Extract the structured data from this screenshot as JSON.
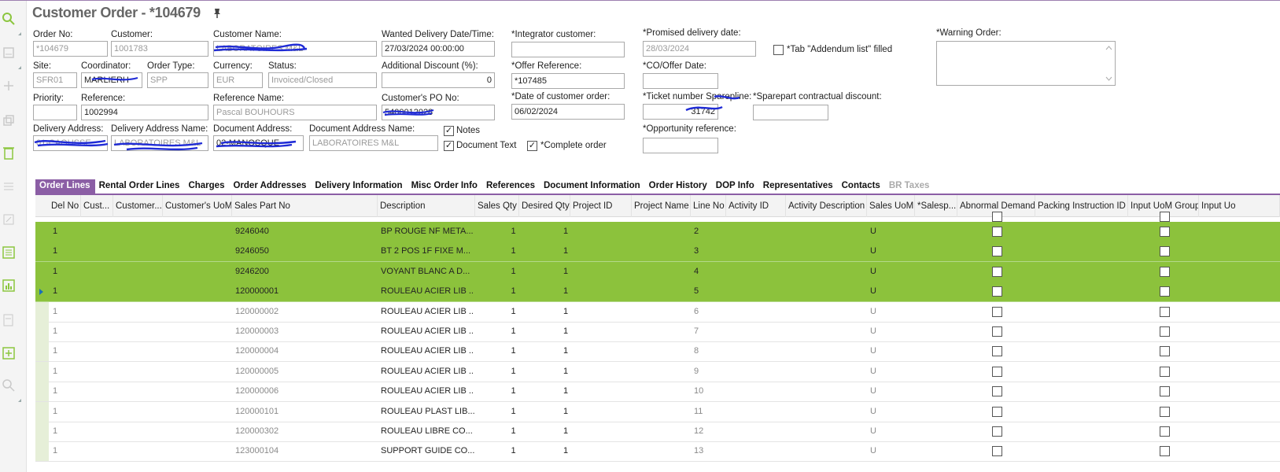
{
  "title": "Customer Order - *104679",
  "header": {
    "order_no": {
      "label": "Order No:",
      "value": "*104679"
    },
    "customer": {
      "label": "Customer:",
      "value": "1001783"
    },
    "customer_name": {
      "label": "Customer Name:",
      "value": "LABORATOIRES M&L"
    },
    "wanted_delivery": {
      "label": "Wanted Delivery Date/Time:",
      "value": "27/03/2024 00:00:00"
    },
    "integrator_customer": {
      "label": "*Integrator customer:",
      "value": ""
    },
    "promised_delivery": {
      "label": "*Promised delivery date:",
      "value": "28/03/2024"
    },
    "tab_addendum": {
      "label": "*Tab \"Addendum list\" filled"
    },
    "warning_order": {
      "label": "*Warning Order:",
      "value": ""
    },
    "site": {
      "label": "Site:",
      "value": "SFR01"
    },
    "coordinator": {
      "label": "Coordinator:",
      "value": "MARLIERH"
    },
    "order_type": {
      "label": "Order Type:",
      "value": "SPP"
    },
    "currency": {
      "label": "Currency:",
      "value": "EUR"
    },
    "status": {
      "label": "Status:",
      "value": "Invoiced/Closed"
    },
    "additional_discount": {
      "label": "Additional Discount (%):",
      "value": "0"
    },
    "offer_reference": {
      "label": "*Offer Reference:",
      "value": "*107485"
    },
    "co_offer_date": {
      "label": "*CO/Offer Date:",
      "value": ""
    },
    "priority": {
      "label": "Priority:",
      "value": ""
    },
    "reference": {
      "label": "Reference:",
      "value": "1002994"
    },
    "reference_name": {
      "label": "Reference Name:",
      "value": "Pascal BOUHOURS"
    },
    "customer_po": {
      "label": "Customer's PO No:",
      "value": "5400012028"
    },
    "date_customer_order": {
      "label": "*Date of customer order:",
      "value": "06/02/2024"
    },
    "ticket_number": {
      "label": "*Ticket number Sparepline:",
      "value": "31742"
    },
    "sparepart_discount": {
      "label": "*Sparepart contractual discount:",
      "value": ""
    },
    "delivery_address": {
      "label": "Delivery Address:",
      "value": "01-CAOUSSE"
    },
    "delivery_address_name": {
      "label": "Delivery Address Name:",
      "value": "LABORATOIRES M&L"
    },
    "document_address": {
      "label": "Document Address:",
      "value": "02-MANOSQUE"
    },
    "document_address_name": {
      "label": "Document Address Name:",
      "value": "LABORATOIRES M&L"
    },
    "notes": {
      "label": "Notes",
      "checked": true
    },
    "document_text": {
      "label": "Document Text",
      "checked": true
    },
    "complete_order": {
      "label": "*Complete order",
      "checked": true
    },
    "opportunity_reference": {
      "label": "*Opportunity reference:",
      "value": ""
    }
  },
  "tabs": [
    {
      "label": "Order Lines",
      "active": true
    },
    {
      "label": "Rental Order Lines"
    },
    {
      "label": "Charges"
    },
    {
      "label": "Order Addresses"
    },
    {
      "label": "Delivery Information"
    },
    {
      "label": "Misc Order Info"
    },
    {
      "label": "References"
    },
    {
      "label": "Document Information"
    },
    {
      "label": "Order History"
    },
    {
      "label": "DOP Info"
    },
    {
      "label": "Representatives"
    },
    {
      "label": "Contacts"
    },
    {
      "label": "BR Taxes",
      "disabled": true
    }
  ],
  "table": {
    "columns": [
      "Del No",
      "Cust...",
      "Customer...",
      "Customer's UoM",
      "Sales Part No",
      "Description",
      "Sales Qty",
      "Desired Qty",
      "Project ID",
      "Project Name",
      "Line No",
      "Activity ID",
      "Activity Description",
      "Sales UoM",
      "*Salesp...",
      "Abnormal Demand",
      "Packing Instruction ID",
      "Input UoM Group",
      "Input Uo"
    ],
    "rows": [
      {
        "del_no": "1",
        "part": "9246040",
        "desc": "BP ROUGE NF META...",
        "sales_qty": "1",
        "desired_qty": "1",
        "line_no": "2",
        "uom": "U",
        "selected": true
      },
      {
        "del_no": "1",
        "part": "9246050",
        "desc": "BT 2 POS 1F FIXE M...",
        "sales_qty": "1",
        "desired_qty": "1",
        "line_no": "3",
        "uom": "U",
        "selected": true
      },
      {
        "del_no": "1",
        "part": "9246200",
        "desc": "VOYANT BLANC  A D...",
        "sales_qty": "1",
        "desired_qty": "1",
        "line_no": "4",
        "uom": "U",
        "selected": true
      },
      {
        "del_no": "1",
        "part": "120000001",
        "desc": "ROULEAU ACIER LIB ...",
        "sales_qty": "1",
        "desired_qty": "1",
        "line_no": "5",
        "uom": "U",
        "selected": true,
        "current": true
      },
      {
        "del_no": "1",
        "part": "120000002",
        "desc": "ROULEAU ACIER LIB ...",
        "sales_qty": "1",
        "desired_qty": "1",
        "line_no": "6",
        "uom": "U"
      },
      {
        "del_no": "1",
        "part": "120000003",
        "desc": "ROULEAU ACIER LIB ...",
        "sales_qty": "1",
        "desired_qty": "1",
        "line_no": "7",
        "uom": "U"
      },
      {
        "del_no": "1",
        "part": "120000004",
        "desc": "ROULEAU ACIER LIB ...",
        "sales_qty": "1",
        "desired_qty": "1",
        "line_no": "8",
        "uom": "U"
      },
      {
        "del_no": "1",
        "part": "120000005",
        "desc": "ROULEAU ACIER LIB ...",
        "sales_qty": "1",
        "desired_qty": "1",
        "line_no": "9",
        "uom": "U"
      },
      {
        "del_no": "1",
        "part": "120000006",
        "desc": "ROULEAU ACIER LIB ...",
        "sales_qty": "1",
        "desired_qty": "1",
        "line_no": "10",
        "uom": "U"
      },
      {
        "del_no": "1",
        "part": "120000101",
        "desc": "ROULEAU PLAST LIB...",
        "sales_qty": "1",
        "desired_qty": "1",
        "line_no": "11",
        "uom": "U"
      },
      {
        "del_no": "1",
        "part": "120000302",
        "desc": "ROULEAU LIBRE CO...",
        "sales_qty": "1",
        "desired_qty": "1",
        "line_no": "12",
        "uom": "U"
      },
      {
        "del_no": "1",
        "part": "123000104",
        "desc": "SUPPORT GUIDE CO...",
        "sales_qty": "1",
        "desired_qty": "1",
        "line_no": "13",
        "uom": "U"
      }
    ]
  },
  "colors": {
    "accent": "#8b5ea5",
    "selection": "#8cc23c",
    "icon": "#8cc63f"
  }
}
